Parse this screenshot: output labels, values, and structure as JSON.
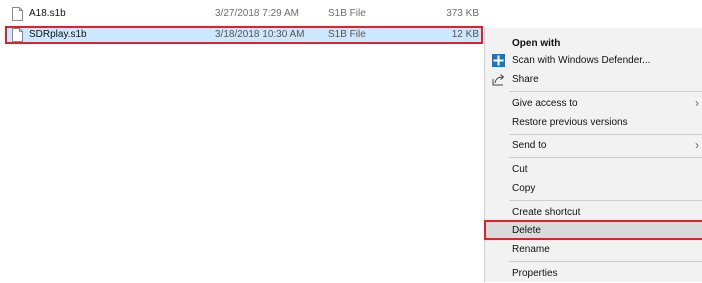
{
  "files": [
    {
      "name": "A18.s1b",
      "date": "3/27/2018 7:29 AM",
      "type": "S1B File",
      "size": "373 KB"
    },
    {
      "name": "SDRplay.s1b",
      "date": "3/18/2018 10:30 AM",
      "type": "S1B File",
      "size": "12 KB"
    }
  ],
  "context_menu": {
    "open_with": "Open with",
    "scan": "Scan with Windows Defender...",
    "share": "Share",
    "give_access": "Give access to",
    "restore": "Restore previous versions",
    "send_to": "Send to",
    "cut": "Cut",
    "copy": "Copy",
    "create_shortcut": "Create shortcut",
    "delete": "Delete",
    "rename": "Rename",
    "properties": "Properties",
    "submenu_arrow": "›"
  },
  "colors": {
    "selection": "#cce8ff",
    "highlight_box": "#e0202a",
    "menu_background": "#f2f2f2",
    "menu_hover": "#dadada"
  },
  "icons": {
    "file": "file-icon",
    "defender": "windows-defender-icon",
    "share": "share-icon",
    "submenu": "chevron-right-icon"
  }
}
